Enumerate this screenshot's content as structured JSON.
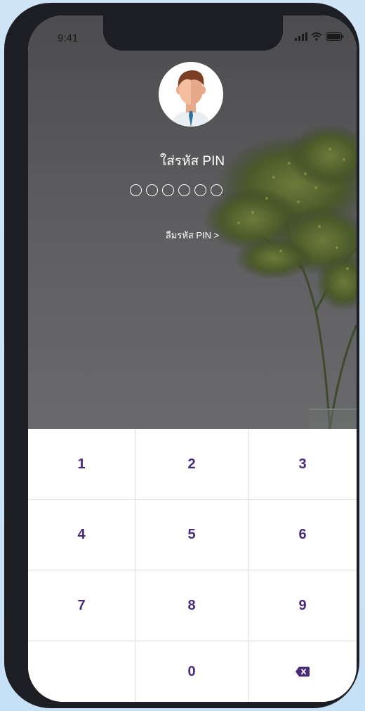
{
  "status_bar": {
    "time": "9:41",
    "icons": [
      "signal-icon",
      "wifi-icon",
      "battery-icon"
    ]
  },
  "pin_screen": {
    "title": "ใส่รหัส PIN",
    "pin_length": 6,
    "forgot_link": "ลืมรหัส PIN >"
  },
  "keypad": {
    "keys": [
      "1",
      "2",
      "3",
      "4",
      "5",
      "6",
      "7",
      "8",
      "9",
      "",
      "0",
      "backspace"
    ]
  },
  "colors": {
    "key_text": "#4a2a7a",
    "hero_bg": "#5a5a5c",
    "page_bg": "#c9e2f6"
  }
}
